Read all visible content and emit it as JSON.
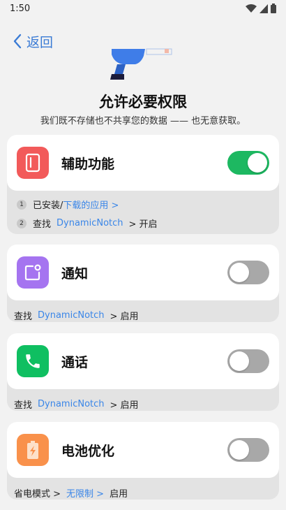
{
  "status": {
    "time": "1:50"
  },
  "nav": {
    "back_label": "返回"
  },
  "header": {
    "title": "允许必要权限",
    "subtitle": "我们既不存储也不共享您的数据 —— 也无意获取。"
  },
  "permissions": [
    {
      "label": "辅助功能",
      "icon": "phone-frame-icon",
      "icon_color": "#f25a5a",
      "enabled": true,
      "steps": [
        {
          "num": "1",
          "text": "已安装/",
          "link": "下载的应用 >"
        },
        {
          "num": "2",
          "prefix": "查找",
          "link": "DynamicNotch",
          "suffix": "> 开启"
        }
      ]
    },
    {
      "label": "通知",
      "icon": "notification-icon",
      "icon_color": "#a574f0",
      "enabled": false,
      "hint": {
        "prefix": "查找",
        "link": "DynamicNotch",
        "suffix": "> 启用"
      }
    },
    {
      "label": "通话",
      "icon": "phone-icon",
      "icon_color": "#0fbf61",
      "enabled": false,
      "hint": {
        "prefix": "查找",
        "link": "DynamicNotch",
        "suffix": "> 启用"
      }
    },
    {
      "label": "电池优化",
      "icon": "battery-charge-icon",
      "icon_color": "#f9914b",
      "enabled": false,
      "hint": {
        "prefix": "省电模式 >",
        "link": "无限制 >",
        "suffix": "启用"
      }
    }
  ],
  "colors": {
    "accent": "#3a86e8",
    "toggle_on": "#1db861",
    "toggle_off": "#a8a8a8"
  }
}
